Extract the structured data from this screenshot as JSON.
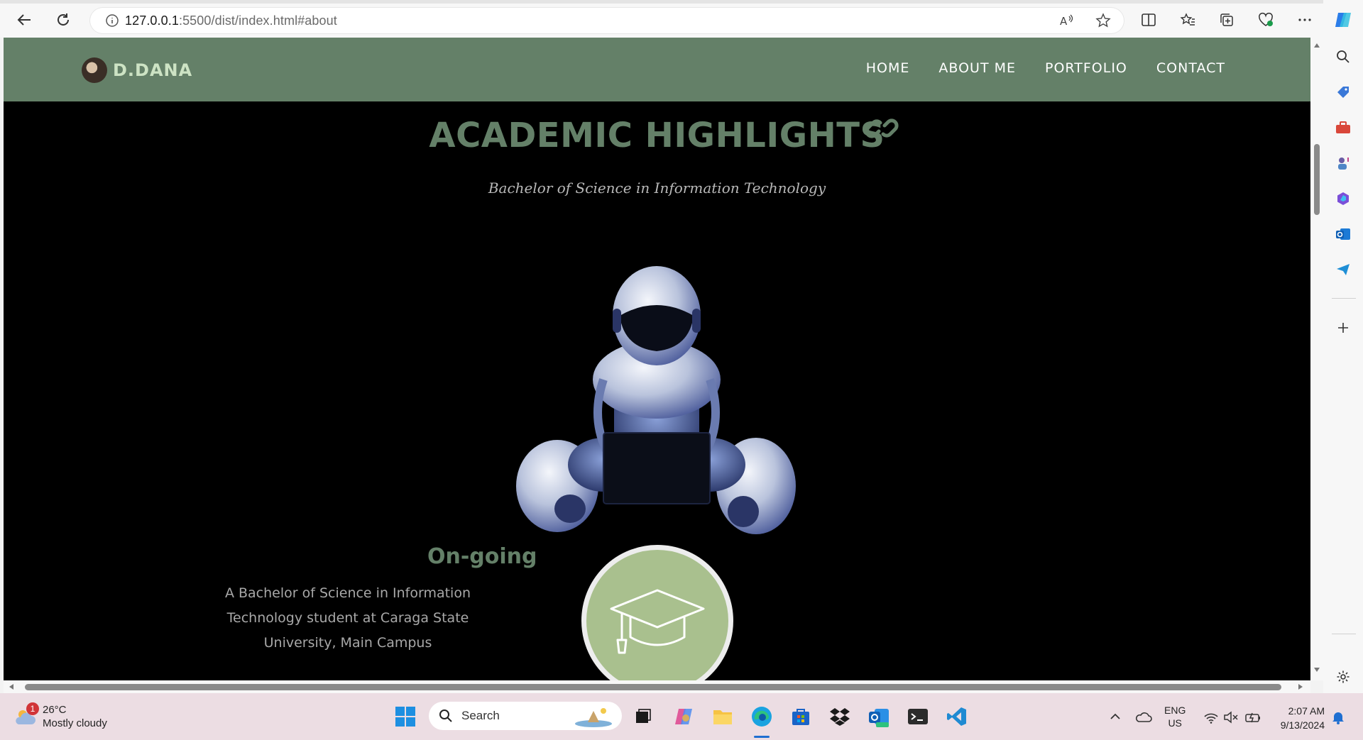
{
  "browser": {
    "url_host": "127.0.0.1",
    "url_path": ":5500/dist/index.html#about"
  },
  "site": {
    "brand": "D.DANA",
    "nav": [
      "HOME",
      "ABOUT ME",
      "PORTFOLIO",
      "CONTACT"
    ],
    "header_color": "#648068"
  },
  "section": {
    "title": "ACADEMIC HIGHLIGHTS",
    "subtitle": "Bachelor of Science in Information Technology",
    "ongoing_title": "On-going",
    "ongoing_text": "A Bachelor of Science in Information Technology student at Caraga State University, Main Campus",
    "circle_color": "#a9c08e"
  },
  "taskbar": {
    "weather_temp": "26°C",
    "weather_desc": "Mostly cloudy",
    "weather_badge": "1",
    "search_placeholder": "Search",
    "lang_top": "ENG",
    "lang_bottom": "US",
    "time": "2:07 AM",
    "date": "9/13/2024"
  }
}
